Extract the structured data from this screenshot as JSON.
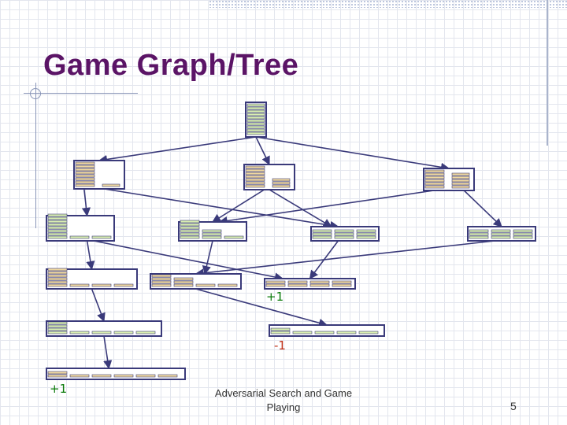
{
  "slide": {
    "title": "Game Graph/Tree",
    "footer": "Adversarial Search and Game Playing",
    "page_number": "5"
  },
  "labels": {
    "plus_one_mid": "+1",
    "minus_one": "-1",
    "plus_one_bottom": "+1"
  },
  "colors": {
    "title": "#5b1466",
    "pile_tan": "#f0d9a0",
    "pile_green": "#d9efb0",
    "outline": "#3a3a7a",
    "edge": "#3a3a7a",
    "win_label": "#0a7a0a",
    "loss_label": "#c03018"
  }
}
